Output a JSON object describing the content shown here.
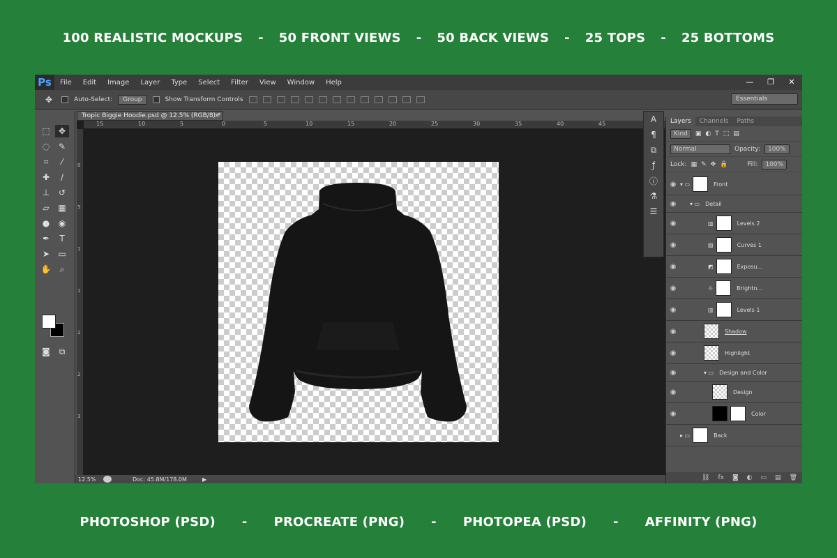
{
  "banner_top": {
    "items": [
      "100 REALISTIC MOCKUPS",
      "50 FRONT VIEWS",
      "50 BACK VIEWS",
      "25 TOPS",
      "25 BOTTOMS"
    ],
    "separator": "-"
  },
  "banner_bottom": {
    "items": [
      "PHOTOSHOP (PSD)",
      "PROCREATE (PNG)",
      "PHOTOPEA (PSD)",
      "AFFINITY (PNG)"
    ],
    "separator": "-"
  },
  "app": {
    "logo": "Ps",
    "menu": [
      "File",
      "Edit",
      "Image",
      "Layer",
      "Type",
      "Select",
      "Filter",
      "View",
      "Window",
      "Help"
    ],
    "window_buttons": [
      "—",
      "❐",
      "✕"
    ]
  },
  "options": {
    "auto_select_label": "Auto-Select:",
    "auto_select_value": "Group",
    "transform_label": "Show Transform Controls",
    "workspace": "Essentials"
  },
  "document": {
    "tab_title": "Tropic Biggie Hoodie.psd @ 12.5% (RGB/8) *",
    "close": "×",
    "zoom": "12.5%",
    "doc_size": "Doc: 45.8M/178.0M",
    "ruler_h": [
      "15",
      "10",
      "5",
      "0",
      "5",
      "10",
      "15",
      "20",
      "25",
      "30",
      "35",
      "40",
      "45"
    ],
    "ruler_v": [
      "0",
      "5",
      "1",
      "1",
      "2",
      "2",
      "3"
    ]
  },
  "layers_panel": {
    "tabs": [
      "Layers",
      "Channels",
      "Paths"
    ],
    "kind": "Kind",
    "blend": "Normal",
    "opacity_label": "Opacity:",
    "opacity": "100%",
    "lock_label": "Lock:",
    "fill_label": "Fill:",
    "fill": "100%",
    "layers": [
      {
        "name": "Front",
        "type": "group"
      },
      {
        "name": "Detail",
        "type": "subgroup"
      },
      {
        "name": "Levels 2",
        "type": "adjust"
      },
      {
        "name": "Curves 1",
        "type": "adjust"
      },
      {
        "name": "Exposu...",
        "type": "adjust"
      },
      {
        "name": "Brightn...",
        "type": "adjust"
      },
      {
        "name": "Levels 1",
        "type": "adjust"
      },
      {
        "name": "Shadow",
        "type": "layer"
      },
      {
        "name": "Highlight",
        "type": "layer"
      },
      {
        "name": "Design and Color",
        "type": "subgroup"
      },
      {
        "name": "Design",
        "type": "smart"
      },
      {
        "name": "Color",
        "type": "fill"
      },
      {
        "name": "Back",
        "type": "group"
      }
    ]
  },
  "colors": {
    "accent": "#25803a",
    "hoodie": "#151515"
  }
}
